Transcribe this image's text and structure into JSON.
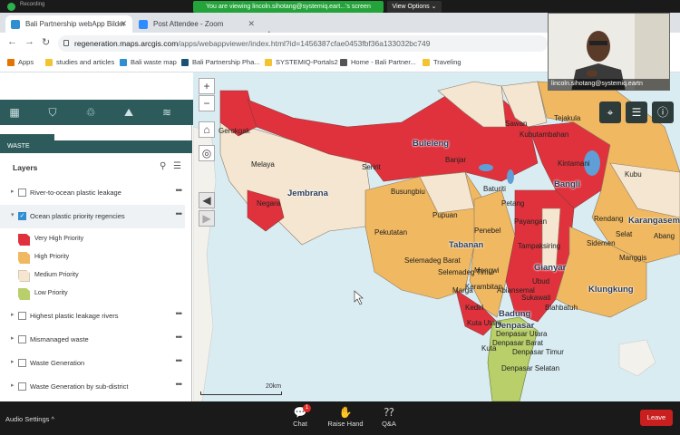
{
  "zoom": {
    "recording_label": "Recording",
    "viewing_banner": "You are viewing lincoln.sihotang@systemiq.eart...'s screen",
    "view_options": "View Options ⌄",
    "audio_settings": "Audio Settings ^",
    "chat": "Chat",
    "chat_badge": "1",
    "raise_hand": "Raise Hand",
    "qa": "Q&A",
    "leave": "Leave",
    "participant_name": "lincoln.sihotang@systemiq.eartn"
  },
  "browser": {
    "tabs": [
      {
        "title": "Bali Partnership webApp Bilder",
        "icon_color": "#2f8fd0"
      },
      {
        "title": "Post Attendee - Zoom",
        "icon_color": "#2d8cff"
      }
    ],
    "url_host": "regeneration.maps.arcgis.com",
    "url_path": "/apps/webappviewer/index.html?id=1456387cfae0453fbf36a133032bc749",
    "bookmarks": [
      {
        "label": "Apps",
        "color": "#e37400"
      },
      {
        "label": "studies and articles",
        "color": "#f4c430"
      },
      {
        "label": "Bali waste map",
        "color": "#2f8fd0"
      },
      {
        "label": "Bali Partnership Pha...",
        "color": "#1a5276"
      },
      {
        "label": "SYSTEMIQ-Portals2",
        "color": "#f4c430"
      },
      {
        "label": "Home - Bali Partner...",
        "color": "#555555"
      },
      {
        "label": "Traveling",
        "color": "#f4c430"
      }
    ]
  },
  "panel": {
    "header": "WASTE",
    "layers_title": "Layers",
    "layers": [
      {
        "label": "River-to-ocean plastic leakage",
        "checked": false
      },
      {
        "label": "Ocean plastic priority regencies",
        "checked": true
      },
      {
        "label": "Highest plastic leakage rivers",
        "checked": false
      },
      {
        "label": "Mismanaged waste",
        "checked": false
      },
      {
        "label": "Waste Generation",
        "checked": false
      },
      {
        "label": "Waste Generation by sub-district",
        "checked": false
      }
    ],
    "legend": [
      {
        "label": "Very High Priority",
        "color": "#e0323c"
      },
      {
        "label": "High Priority",
        "color": "#f0b860"
      },
      {
        "label": "Medium Priority",
        "color": "#f4e6d0"
      },
      {
        "label": "Low Priority",
        "color": "#b8cf6a"
      }
    ]
  },
  "map": {
    "scale_label": "20km",
    "regencies": [
      {
        "name": "Buleleng",
        "priority": "very-high"
      },
      {
        "name": "Jembrana",
        "priority": "medium"
      },
      {
        "name": "Tabanan",
        "priority": "high"
      },
      {
        "name": "Bangli",
        "priority": "very-high"
      },
      {
        "name": "Karangasem",
        "priority": "high"
      },
      {
        "name": "Gianyar",
        "priority": "very-high"
      },
      {
        "name": "Klungkung",
        "priority": "high"
      },
      {
        "name": "Badung",
        "priority": "high"
      },
      {
        "name": "Denpasar",
        "priority": "low"
      }
    ],
    "small_labels": [
      "Melaya",
      "Negara",
      "Pekutatan",
      "Busungbiu",
      "Banjar",
      "Pupuan",
      "Penebel",
      "Selemadeg Barat",
      "Selemadeg Timur",
      "Kerambitan",
      "Kintamani",
      "Kubu",
      "Rendang",
      "Sidemen",
      "Selat",
      "Abang",
      "Manggis",
      "Tampaksiring",
      "Payangan",
      "Ubud",
      "Blahbatuh",
      "Sukawati",
      "Abiansemal",
      "Mengwi",
      "Kuta Utara",
      "Kuta",
      "Denpasar Utara",
      "Denpasar Barat",
      "Denpasar Timur",
      "Denpasar Selatan",
      "Sawan",
      "Kubutambahan",
      "Tejakula",
      "Seririt",
      "Gerokgak",
      "Marga",
      "Baturiti",
      "Petang",
      "Kediri"
    ]
  }
}
